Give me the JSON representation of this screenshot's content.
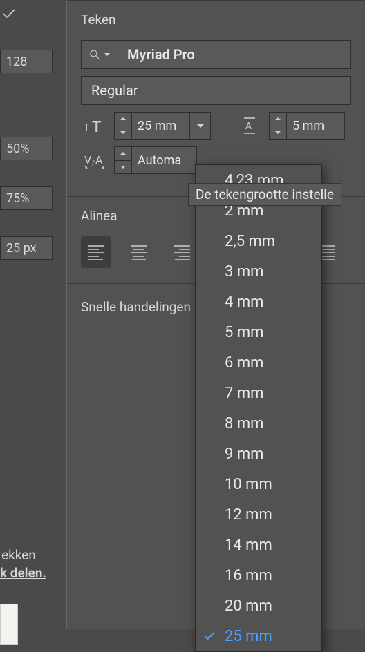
{
  "left": {
    "v128": "128",
    "v50": "50%",
    "v75": "75%",
    "v25px": "25 px",
    "ekken": "ekken",
    "delen": "k delen."
  },
  "teken": {
    "title": "Teken",
    "font": "Myriad Pro",
    "style": "Regular",
    "size": "25 mm",
    "leading": "5 mm",
    "kerning": "Automa"
  },
  "alinea": {
    "title": "Alinea"
  },
  "snelle": {
    "title": "Snelle handelingen"
  },
  "tooltip": "De tekengrootte instelle",
  "sizes": {
    "custom": "4,23 mm",
    "items": [
      "2 mm",
      "2,5 mm",
      "3 mm",
      "4 mm",
      "5 mm",
      "6 mm",
      "7 mm",
      "8 mm",
      "9 mm",
      "10 mm",
      "12 mm",
      "14 mm",
      "16 mm",
      "20 mm",
      "25 mm"
    ],
    "selected": "25 mm"
  }
}
